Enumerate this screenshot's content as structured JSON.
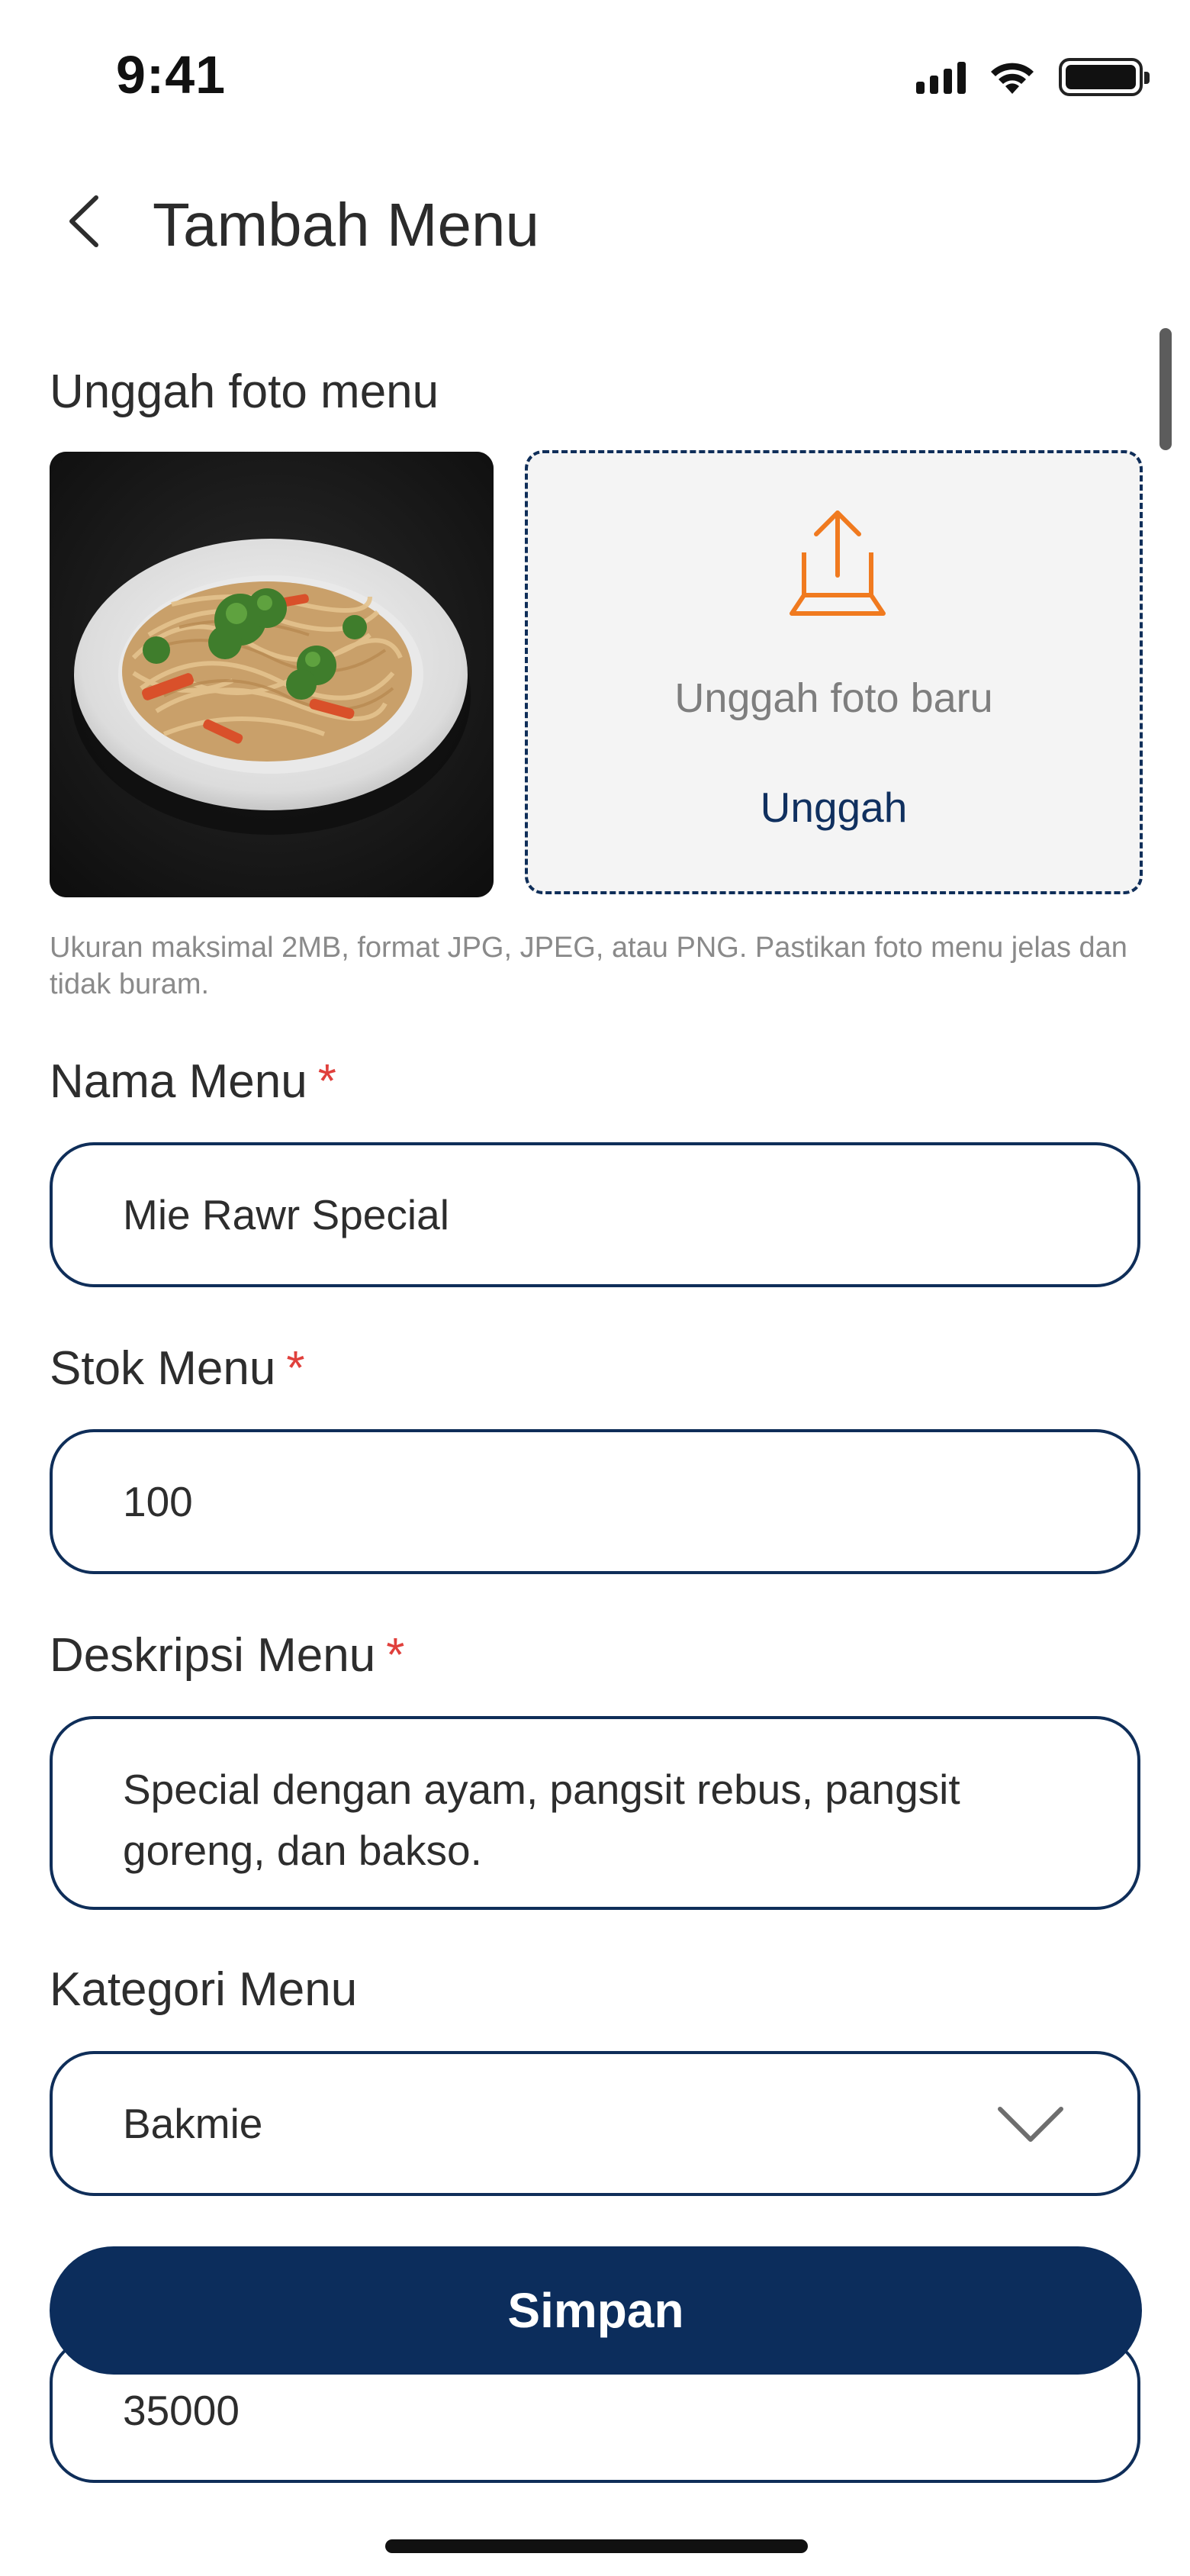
{
  "status_bar": {
    "time": "9:41"
  },
  "header": {
    "title": "Tambah Menu",
    "back_icon": "chevron-left-icon"
  },
  "photo_section": {
    "label": "Unggah foto menu",
    "upload_box": {
      "text": "Unggah foto baru",
      "link_label": "Unggah",
      "icon": "upload-icon",
      "icon_color": "#f07a1f"
    },
    "hint": "Ukuran maksimal 2MB, format JPG, JPEG, atau PNG. Pastikan foto menu jelas dan tidak buram."
  },
  "form": {
    "required_marker": "*",
    "nama_menu": {
      "label": "Nama Menu",
      "value": "Mie Rawr Special"
    },
    "stok_menu": {
      "label": "Stok Menu",
      "value": "100"
    },
    "deskripsi_menu": {
      "label": "Deskripsi Menu",
      "value": "Special dengan ayam, pangsit rebus, pangsit goreng, dan bakso."
    },
    "kategori_menu": {
      "label": "Kategori Menu",
      "value": "Bakmie",
      "icon": "chevron-down-icon"
    },
    "harga_menu": {
      "value": "35000"
    }
  },
  "actions": {
    "save_label": "Simpan"
  },
  "colors": {
    "primary": "#0c2d5c",
    "accent": "#f07a1f",
    "required": "#e0403c"
  }
}
